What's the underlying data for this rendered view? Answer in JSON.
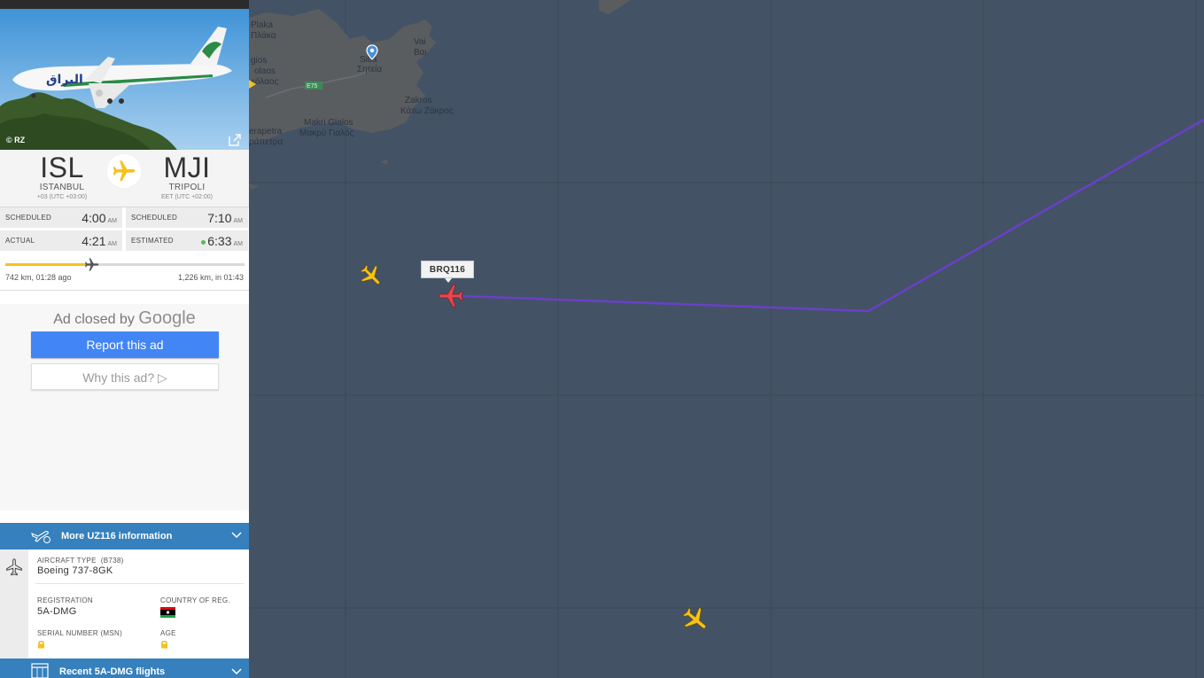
{
  "map": {
    "labels": [
      {
        "text": "Vai"
      },
      {
        "text": "Βαι"
      },
      {
        "text": "Sitia"
      },
      {
        "text": "Σητεία"
      },
      {
        "text": "Zakros"
      },
      {
        "text": "Κάτω Ζάκρος"
      },
      {
        "text": "Makri Gialos"
      },
      {
        "text": "Μακρύ Γιαλός"
      },
      {
        "text": "erapetra"
      },
      {
        "text": "ράπετρα"
      },
      {
        "text": "Plaka"
      },
      {
        "text": "Πλάκα"
      },
      {
        "text": "gios"
      },
      {
        "text": "olaos"
      },
      {
        "text": "κόλαος"
      },
      {
        "text": "E75"
      }
    ],
    "selected_flight_callsign": "BRQ116",
    "track_color": "#6a3fc8",
    "selected_plane_color": "#e8464e",
    "other_plane_color": "#f5c21b"
  },
  "panel": {
    "photo_credit": "© RZ",
    "route": {
      "origin": {
        "code": "ISL",
        "city": "ISTANBUL",
        "tz": "+03 (UTC +03:00)"
      },
      "destination": {
        "code": "MJI",
        "city": "TRIPOLI",
        "tz": "EET (UTC +02:00)"
      }
    },
    "times": {
      "dep_scheduled_label": "SCHEDULED",
      "dep_scheduled": "4:00",
      "dep_scheduled_ampm": "AM",
      "dep_actual_label": "ACTUAL",
      "dep_actual": "4:21",
      "dep_actual_ampm": "AM",
      "arr_scheduled_label": "SCHEDULED",
      "arr_scheduled": "7:10",
      "arr_scheduled_ampm": "AM",
      "arr_estimated_label": "ESTIMATED",
      "arr_estimated": "6:33",
      "arr_estimated_ampm": "AM"
    },
    "progress": {
      "fraction": 0.377,
      "left": "742 km, 01:28 ago",
      "right": "1,226 km, in 01:43"
    },
    "ad": {
      "closed_prefix": "Ad closed by",
      "closed_brand": "Google",
      "report": "Report this ad",
      "why": "Why this ad? ▷"
    },
    "more_info": "More UZ116 information",
    "details": {
      "aircraft_type_label": "AIRCRAFT TYPE",
      "aircraft_type_code": "(B738)",
      "aircraft_type": "Boeing 737-8GK",
      "registration_label": "REGISTRATION",
      "registration": "5A-DMG",
      "country_label": "COUNTRY OF REG.",
      "msn_label": "SERIAL NUMBER (MSN)",
      "age_label": "AGE"
    },
    "recent_flights": "Recent 5A-DMG flights"
  }
}
